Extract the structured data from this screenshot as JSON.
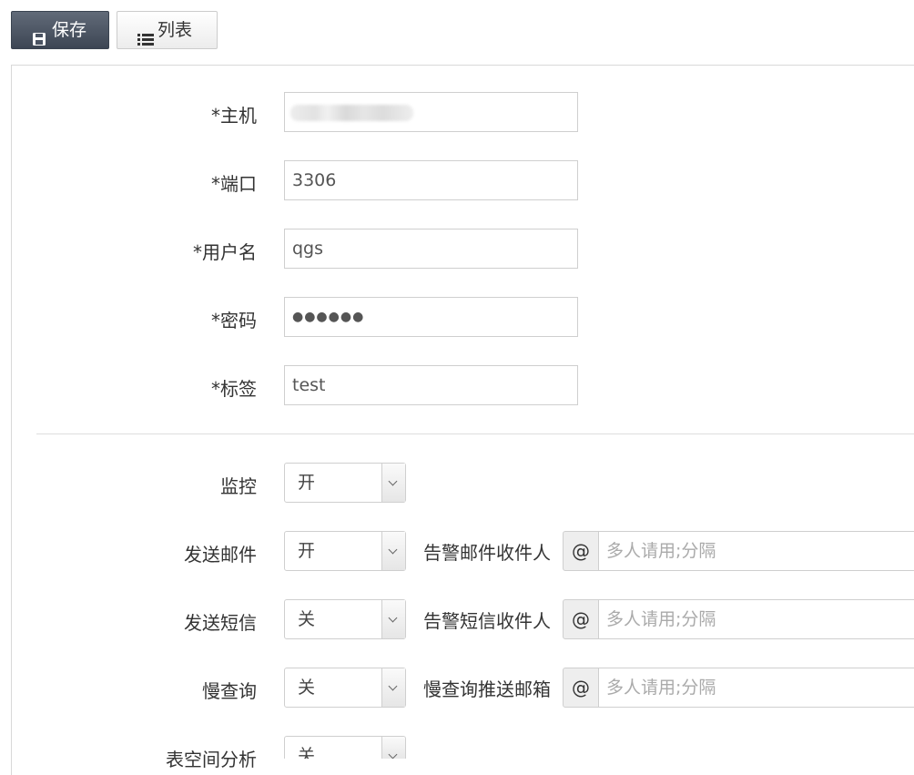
{
  "toolbar": {
    "save_label": "保存",
    "list_label": "列表"
  },
  "form": {
    "host": {
      "label": "*主机",
      "value": ""
    },
    "port": {
      "label": "*端口",
      "value": "3306"
    },
    "username": {
      "label": "*用户名",
      "value": "qgs"
    },
    "password": {
      "label": "*密码",
      "value": "●●●●●●"
    },
    "tag": {
      "label": "*标签",
      "value": "test"
    },
    "monitor": {
      "label": "监控",
      "value": "开"
    },
    "send_mail": {
      "label": "发送邮件",
      "value": "开",
      "recipient_label": "告警邮件收件人",
      "addon": "@",
      "placeholder": "多人请用;分隔"
    },
    "send_sms": {
      "label": "发送短信",
      "value": "关",
      "recipient_label": "告警短信收件人",
      "addon": "@",
      "placeholder": "多人请用;分隔"
    },
    "slow_query": {
      "label": "慢查询",
      "value": "关",
      "recipient_label": "慢查询推送邮箱",
      "addon": "@",
      "placeholder": "多人请用;分隔"
    },
    "table_space": {
      "label": "表空间分析",
      "value": "关"
    }
  }
}
